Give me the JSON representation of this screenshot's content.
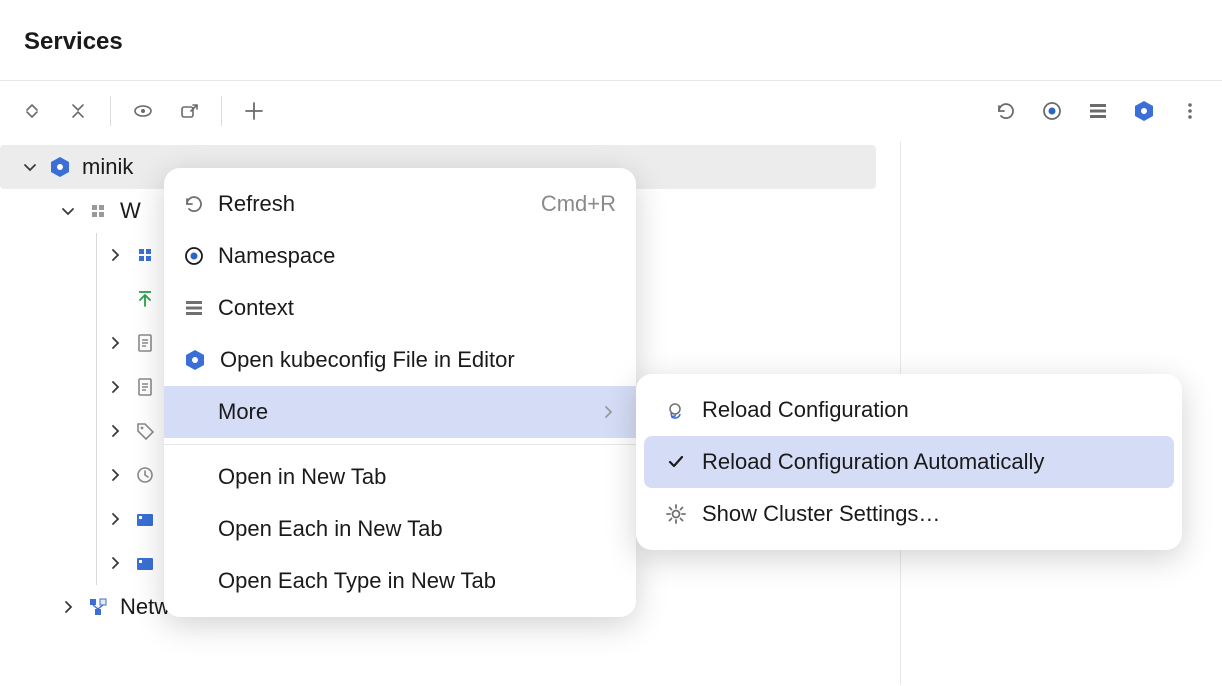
{
  "header": {
    "title": "Services"
  },
  "toolbar": {
    "left": [
      "expand-all",
      "collapse-all",
      "view",
      "new-tab",
      "add"
    ],
    "right": [
      "refresh",
      "namespace",
      "context",
      "kubernetes",
      "more-vert"
    ]
  },
  "tree": {
    "root": {
      "label": "minik"
    },
    "child_w": {
      "label": "W"
    },
    "network": {
      "label": "Network"
    }
  },
  "context_menu": {
    "refresh": {
      "label": "Refresh",
      "shortcut": "Cmd+R"
    },
    "namespace": {
      "label": "Namespace"
    },
    "context": {
      "label": "Context"
    },
    "open_kubeconfig": {
      "label": "Open kubeconfig File in Editor"
    },
    "more": {
      "label": "More"
    },
    "open_new_tab": {
      "label": "Open in New Tab"
    },
    "open_each_new_tab": {
      "label": "Open Each in New Tab"
    },
    "open_each_type_new_tab": {
      "label": "Open Each Type in New Tab"
    }
  },
  "submenu": {
    "reload_config": {
      "label": "Reload Configuration"
    },
    "reload_config_auto": {
      "label": "Reload Configuration Automatically",
      "checked": true
    },
    "show_cluster_settings": {
      "label": "Show Cluster Settings…"
    }
  }
}
